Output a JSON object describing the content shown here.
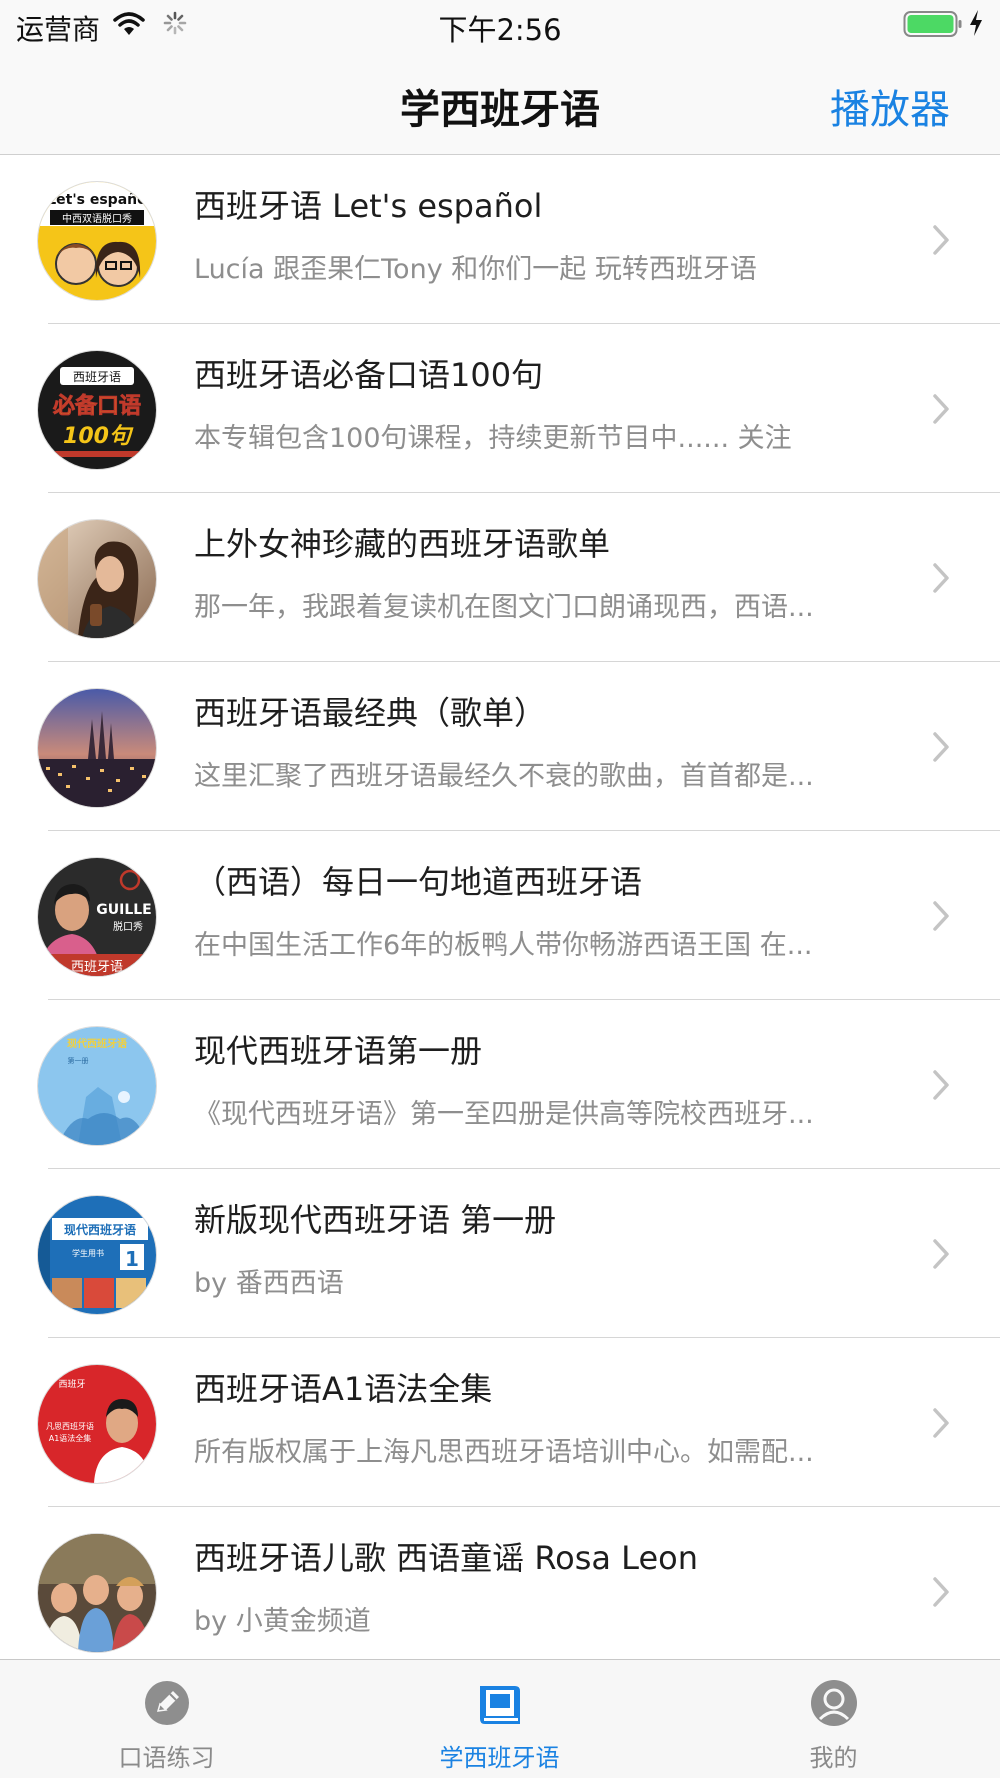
{
  "status_bar": {
    "carrier": "运营商",
    "time": "下午2:56",
    "battery_color": "#4cd964"
  },
  "nav": {
    "title": "学西班牙语",
    "player_button": "播放器"
  },
  "accent_color": "#1a82e2",
  "list": {
    "items": [
      {
        "title": "西班牙语 Let's español",
        "subtitle": "Lucía 跟歪果仁Tony 和你们一起 玩转西班牙语",
        "thumb_text": "Let's españo",
        "thumb_caption": "中西双语脱口秀"
      },
      {
        "title": "西班牙语必备口语100句",
        "subtitle": "本专辑包含100句课程，持续更新节目中...... 关注",
        "thumb_text": "西班牙语",
        "thumb_caption": "必备口语",
        "thumb_number": "100句"
      },
      {
        "title": "上外女神珍藏的西班牙语歌单",
        "subtitle": "那一年，我跟着复读机在图文门口朗诵现西，西语..."
      },
      {
        "title": "西班牙语最经典（歌单）",
        "subtitle": "这里汇聚了西班牙语最经久不衰的歌曲，首首都是..."
      },
      {
        "title": "（西语）每日一句地道西班牙语",
        "subtitle": "在中国生活工作6年的板鸭人带你畅游西语王国 在...",
        "thumb_text": "GUILLE",
        "thumb_caption": "脱口秀",
        "thumb_number": "西班牙语"
      },
      {
        "title": "现代西班牙语第一册",
        "subtitle": "《现代西班牙语》第一至四册是供高等院校西班牙...",
        "thumb_text": "现代西班牙语",
        "thumb_caption": "第一册"
      },
      {
        "title": "新版现代西班牙语 第一册",
        "subtitle": "by 番西西语",
        "thumb_text": "现代西班牙语",
        "thumb_caption": "学生用书",
        "thumb_number": "1"
      },
      {
        "title": "西班牙语A1语法全集",
        "subtitle": "所有版权属于上海凡思西班牙语培训中心。如需配...",
        "thumb_text": "西班牙",
        "thumb_caption": "凡思西班牙语",
        "thumb_number": "A1语法全集"
      },
      {
        "title": "西班牙语儿歌 西语童谣 Rosa Leon",
        "subtitle": "by 小黄金频道"
      }
    ]
  },
  "tab_bar": {
    "tabs": [
      {
        "label": "口语练习",
        "icon": "pencil-icon",
        "active": false
      },
      {
        "label": "学西班牙语",
        "icon": "book-icon",
        "active": true
      },
      {
        "label": "我的",
        "icon": "profile-icon",
        "active": false
      }
    ]
  }
}
